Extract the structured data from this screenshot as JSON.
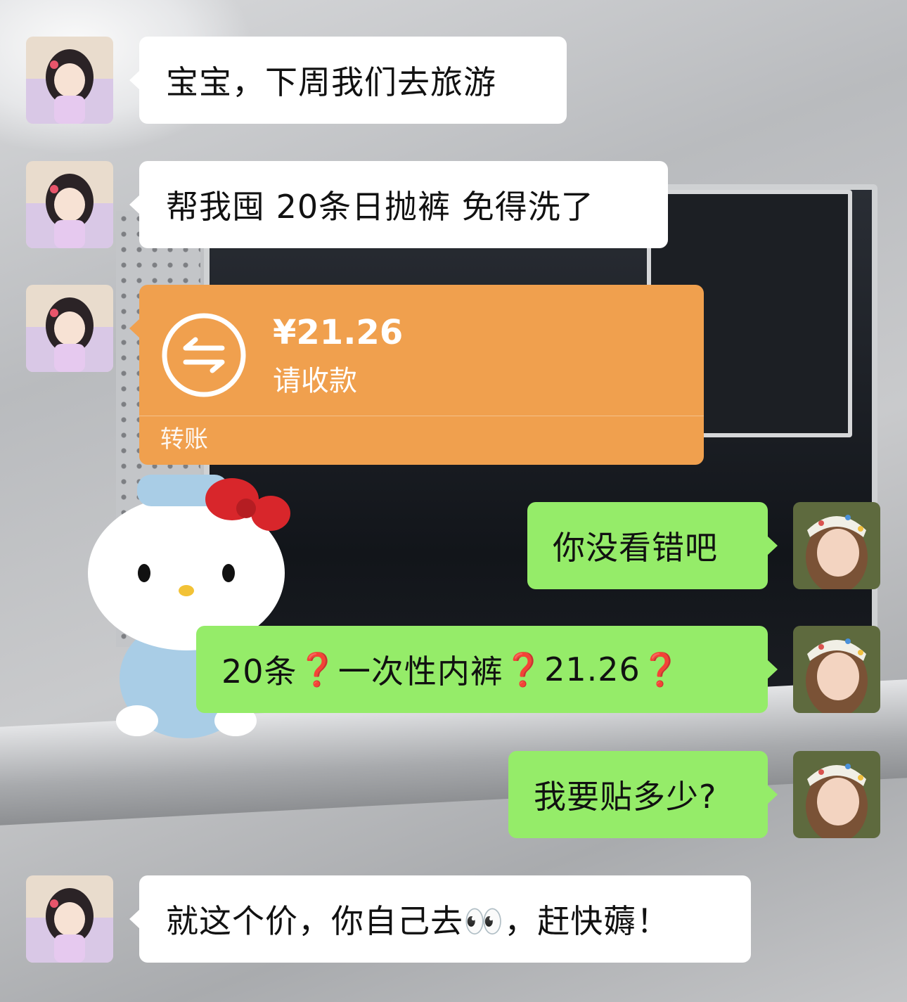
{
  "messages": [
    {
      "side": "left",
      "type": "text",
      "text": "宝宝，下周我们去旅游"
    },
    {
      "side": "left",
      "type": "text",
      "text": "帮我囤 20条日抛裤 免得洗了"
    },
    {
      "side": "left",
      "type": "transfer",
      "amount": "¥21.26",
      "status": "请收款",
      "footer": "转账"
    },
    {
      "side": "right",
      "type": "text",
      "text": "你没看错吧"
    },
    {
      "side": "right",
      "type": "text",
      "parts": [
        "20条",
        "❓",
        "一次性内裤",
        "❓",
        "21.26",
        "❓"
      ]
    },
    {
      "side": "right",
      "type": "text",
      "text": "我要贴多少?"
    },
    {
      "side": "left",
      "type": "text",
      "text": "就这个价，你自己去👀，赶快薅！"
    }
  ],
  "colors": {
    "incoming_bubble": "#ffffff",
    "outgoing_bubble": "#95ec69",
    "transfer_card": "#f0a04e"
  },
  "icons": {
    "transfer": "transfer-arrows-icon",
    "avatar_left": "anime-girl-avatar",
    "avatar_right": "photo-girl-avatar"
  }
}
